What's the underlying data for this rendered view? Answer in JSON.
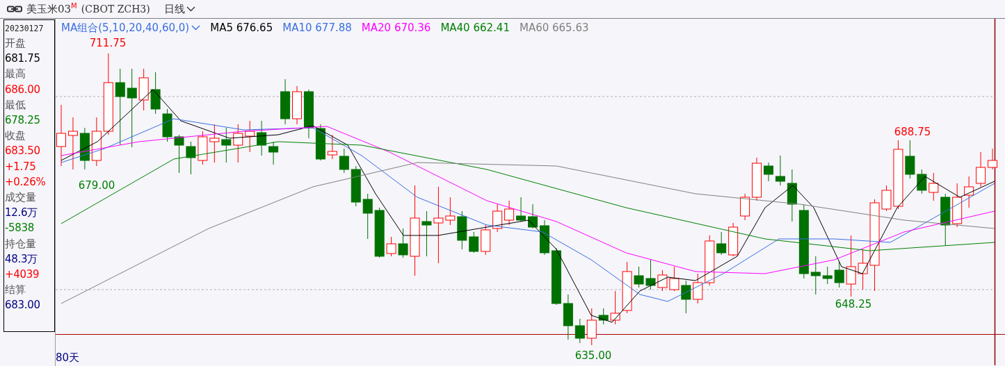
{
  "header": {
    "title": "美玉米03",
    "title_mark": "M",
    "code": "(CBOT ZCH3)",
    "period": "日线"
  },
  "info": {
    "date": "20230127",
    "items": [
      {
        "kind": "label",
        "text": "开盘"
      },
      {
        "kind": "value",
        "text": "681.75",
        "color": "#000000"
      },
      {
        "kind": "label",
        "text": "最高"
      },
      {
        "kind": "value",
        "text": "686.00",
        "color": "#ff0000"
      },
      {
        "kind": "label",
        "text": "最低"
      },
      {
        "kind": "value",
        "text": "678.25",
        "color": "#008000"
      },
      {
        "kind": "label",
        "text": "收盘"
      },
      {
        "kind": "value",
        "text": "683.50",
        "color": "#ff0000"
      },
      {
        "kind": "value",
        "text": "+1.75",
        "color": "#ff0000"
      },
      {
        "kind": "value",
        "text": "+0.26%",
        "color": "#ff0000"
      },
      {
        "kind": "label",
        "text": "成交量"
      },
      {
        "kind": "value",
        "text": "12.6万",
        "color": "#000080"
      },
      {
        "kind": "value",
        "text": "-5838",
        "color": "#008000"
      },
      {
        "kind": "label",
        "text": "持仓量"
      },
      {
        "kind": "value",
        "text": "48.3万",
        "color": "#000080"
      },
      {
        "kind": "value",
        "text": "+4039",
        "color": "#ff0000"
      },
      {
        "kind": "label",
        "text": "结算"
      },
      {
        "kind": "value",
        "text": "683.00",
        "color": "#000080"
      }
    ]
  },
  "legend": {
    "group": "MA组合(5,10,20,40,60,0)",
    "lines": [
      {
        "name": "MA5",
        "value": "676.65",
        "color": "#000000"
      },
      {
        "name": "MA10",
        "value": "677.88",
        "color": "#3b6fe0"
      },
      {
        "name": "MA20",
        "value": "670.36",
        "color": "#ff00ff"
      },
      {
        "name": "MA40",
        "value": "662.41",
        "color": "#008000"
      },
      {
        "name": "MA60",
        "value": "665.63",
        "color": "#808080"
      }
    ]
  },
  "annotations": [
    {
      "text": "711.75",
      "color": "#ff0000"
    },
    {
      "text": "679.00",
      "color": "#008000"
    },
    {
      "text": "635.00",
      "color": "#008000"
    },
    {
      "text": "648.25",
      "color": "#008000"
    },
    {
      "text": "688.75",
      "color": "#ff0000"
    }
  ],
  "footer": {
    "range": "80天"
  }
}
